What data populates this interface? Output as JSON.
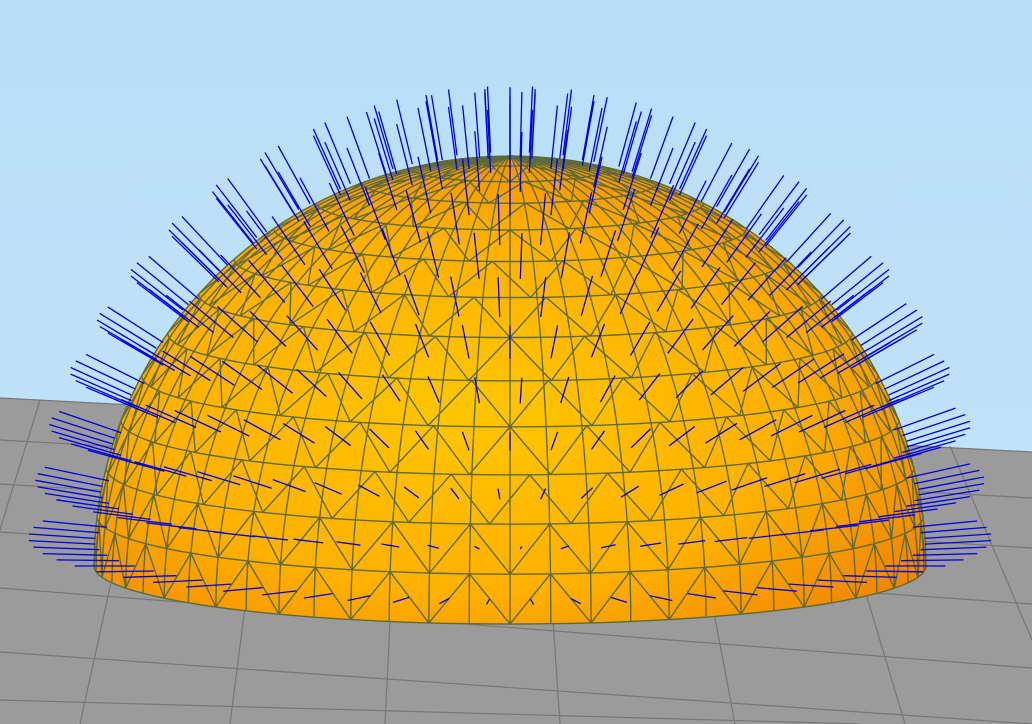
{
  "scene": {
    "description_free": true,
    "background_color": "#bde2f8",
    "floor": {
      "color": "#9b9b9b",
      "grid_line_color": "#777777"
    },
    "hemisphere": {
      "fill_center": "#ffc400",
      "fill_edge": "#f08a00",
      "mesh_line_color": "#5f6a3a",
      "latitude_rings": 13,
      "longitude_segments": 32
    },
    "normals": {
      "color": "#0000e6",
      "visible": true
    }
  }
}
